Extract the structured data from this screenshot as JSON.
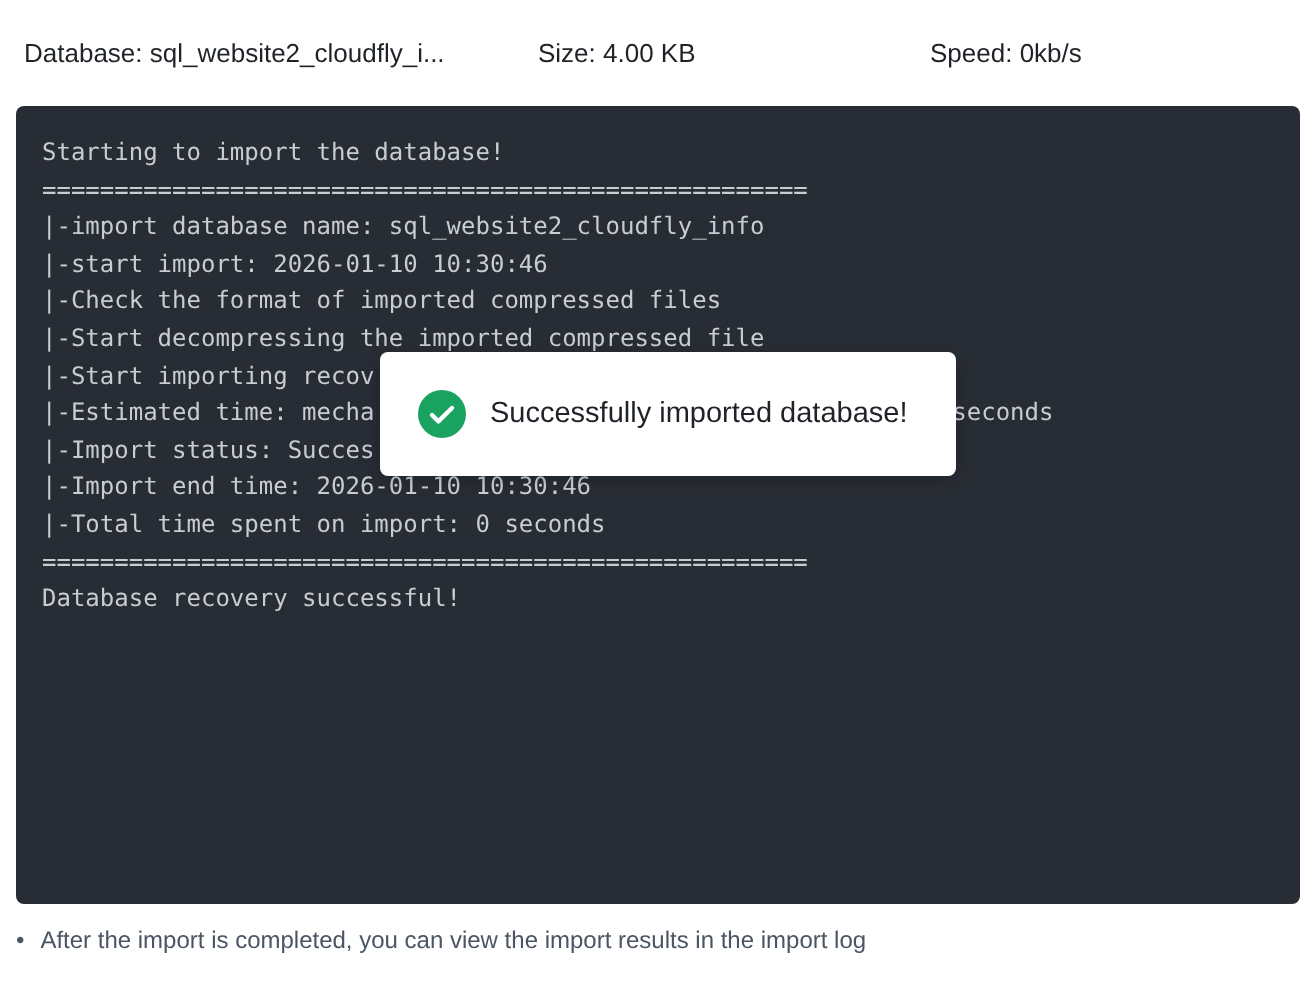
{
  "header": {
    "database": "Database: sql_website2_cloudfly_i...",
    "size": "Size: 4.00 KB",
    "speed": "Speed: 0kb/s"
  },
  "console_lines": [
    {
      "text": "Starting to import the database!"
    },
    {
      "text": "====================================================="
    },
    {
      "text": "|-import database name: sql_website2_cloudfly_info"
    },
    {
      "text": "|-start import: 2026-01-10 10:30:46"
    },
    {
      "text": "|-Check the format of imported compressed files"
    },
    {
      "text": "|-Start decompressing the imported compressed file"
    },
    {
      "text": "|-Start importing recov"
    },
    {
      "text": "|-Estimated time: mecha",
      "tail": "seconds"
    },
    {
      "text": "|-Import status: Succes"
    },
    {
      "text": "|-Import end time: 2026-01-10 10:30:46"
    },
    {
      "text": "|-Total time spent on import: 0 seconds"
    },
    {
      "text": "====================================================="
    },
    {
      "text": "Database recovery successful!"
    }
  ],
  "toast": {
    "message": "Successfully imported database!"
  },
  "notes": [
    {
      "bullet": "•",
      "text": "After the import is completed, you can view the import results in the import log"
    }
  ]
}
